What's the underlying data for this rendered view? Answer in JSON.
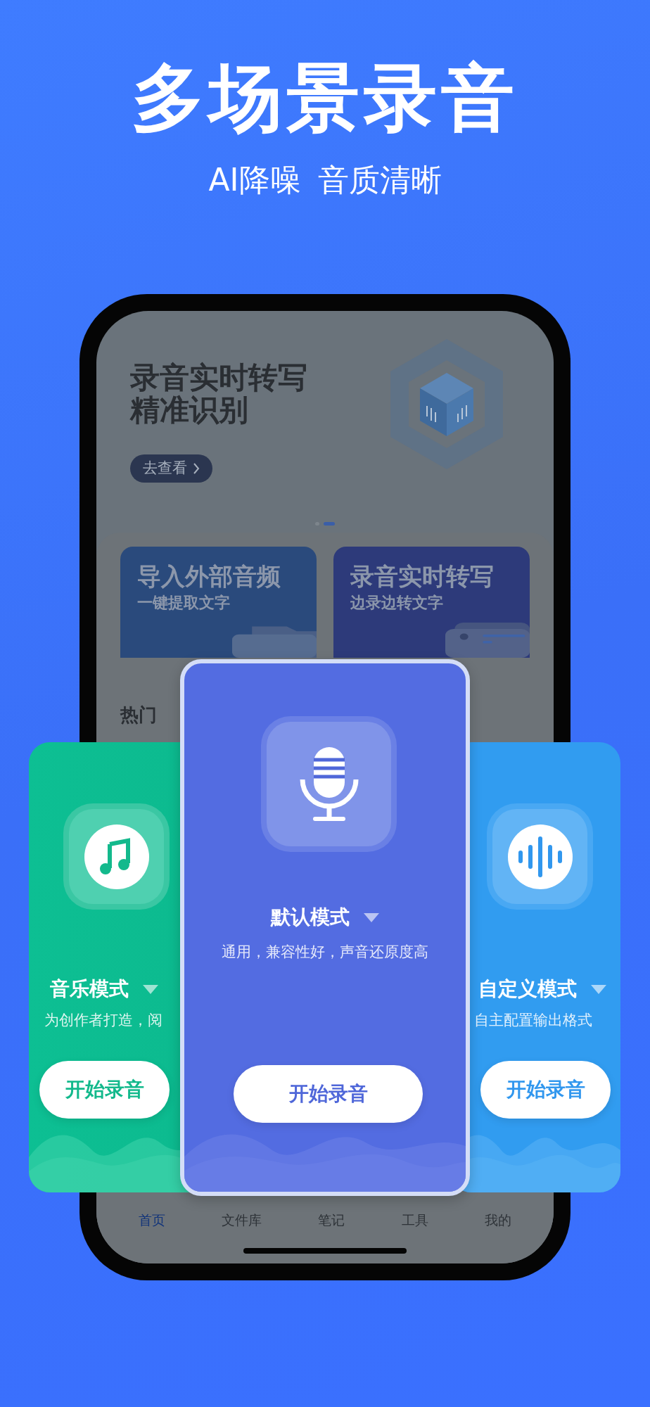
{
  "header": {
    "title": "多场景录音",
    "taglines": [
      "AI降噪",
      "音质清晰"
    ]
  },
  "banner": {
    "lines": [
      "录音实时转写",
      "精准识别"
    ],
    "button": "去查看",
    "dots": [
      {
        "selected": false
      },
      {
        "selected": true
      }
    ]
  },
  "feature_cards": [
    {
      "title": "导入外部音频",
      "subtitle": "一键提取文字",
      "kind": "folder"
    },
    {
      "title": "录音实时转写",
      "subtitle": "边录边转文字",
      "kind": "record"
    }
  ],
  "section_heading": "热门",
  "nav": [
    {
      "label": "首页",
      "selected": true
    },
    {
      "label": "文件库",
      "selected": false
    },
    {
      "label": "笔记",
      "selected": false
    },
    {
      "label": "工具",
      "selected": false
    },
    {
      "label": "我的",
      "selected": false
    }
  ],
  "mode_cards": [
    {
      "kind": "music",
      "title": "音乐模式",
      "description": "为创作者打造，阅",
      "button": "开始录音"
    },
    {
      "kind": "default",
      "title": "默认模式",
      "description": "通用，兼容性好，声音还原度高",
      "button": "开始录音"
    },
    {
      "kind": "custom",
      "title": "自定义模式",
      "description": "自主配置输出格式",
      "button": "开始录音"
    }
  ]
}
